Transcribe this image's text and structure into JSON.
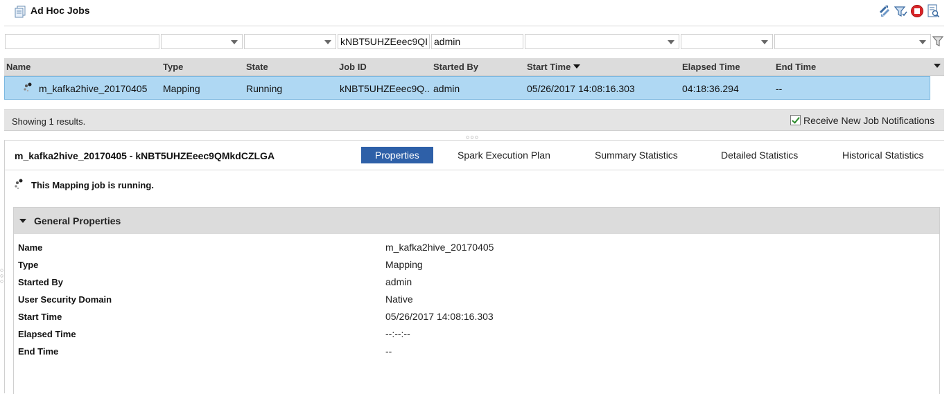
{
  "header": {
    "title": "Ad Hoc Jobs",
    "icons": [
      "ad-hoc-jobs-icon",
      "refresh-icon",
      "filter-icon",
      "stop-icon",
      "view-logs-icon"
    ]
  },
  "filters": {
    "name": "",
    "type": "",
    "state": "",
    "job_id": "kNBT5UHZEeec9QI",
    "started_by": "admin",
    "start_time": "",
    "elapsed_time": "",
    "end_time": ""
  },
  "table": {
    "columns": [
      "Name",
      "Type",
      "State",
      "Job ID",
      "Started By",
      "Start Time",
      "Elapsed Time",
      "End Time"
    ],
    "sorted_column": "Start Time",
    "rows": [
      {
        "name": "m_kafka2hive_20170405",
        "type": "Mapping",
        "state": "Running",
        "job_id": "kNBT5UHZEeec9Q..",
        "started_by": "admin",
        "start_time": "05/26/2017 14:08:16.303",
        "elapsed_time": "04:18:36.294",
        "end_time": "--"
      }
    ]
  },
  "footer": {
    "showing": "Showing 1 results.",
    "notifications_label": "Receive New Job Notifications",
    "notifications_checked": true
  },
  "detail": {
    "title": "m_kafka2hive_20170405 - kNBT5UHZEeec9QMkdCZLGA",
    "tabs": [
      "Properties",
      "Spark Execution Plan",
      "Summary Statistics",
      "Detailed Statistics",
      "Historical Statistics"
    ],
    "active_tab": "Properties",
    "status_message": "This Mapping job is running.",
    "section_title": "General Properties",
    "properties": [
      {
        "label": "Name",
        "value": "m_kafka2hive_20170405"
      },
      {
        "label": "Type",
        "value": "Mapping"
      },
      {
        "label": "Started By",
        "value": "admin"
      },
      {
        "label": "User Security Domain",
        "value": "Native"
      },
      {
        "label": "Start Time",
        "value": "05/26/2017 14:08:16.303"
      },
      {
        "label": "Elapsed Time",
        "value": "--:--:--"
      },
      {
        "label": "End Time",
        "value": "--"
      }
    ]
  },
  "colors": {
    "selected_row": "#afd8f3",
    "active_tab": "#2e60a8",
    "header_gray": "#dcdcdc"
  }
}
